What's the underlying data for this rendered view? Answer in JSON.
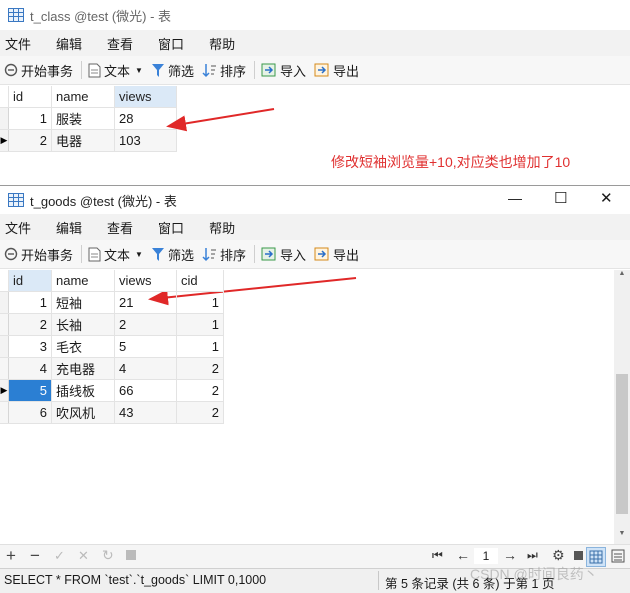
{
  "top_window": {
    "title": "t_class @test (微光) - 表",
    "menu": [
      "文件",
      "编辑",
      "查看",
      "窗口",
      "帮助"
    ],
    "toolbar": {
      "begin_tx": "开始事务",
      "text": "文本",
      "filter": "筛选",
      "sort": "排序",
      "import": "导入",
      "export": "导出"
    },
    "columns": [
      "id",
      "name",
      "views"
    ],
    "rows": [
      {
        "id": "1",
        "name": "服装",
        "views": "28"
      },
      {
        "id": "2",
        "name": "电器",
        "views": "103"
      }
    ]
  },
  "annotation": "修改短袖浏览量+10,对应类也增加了10",
  "bottom_window": {
    "title": "t_goods @test (微光) - 表",
    "menu": [
      "文件",
      "编辑",
      "查看",
      "窗口",
      "帮助"
    ],
    "toolbar": {
      "begin_tx": "开始事务",
      "text": "文本",
      "filter": "筛选",
      "sort": "排序",
      "import": "导入",
      "export": "导出"
    },
    "controls": {
      "minimize": "—",
      "maximize": "☐",
      "close": "✕"
    },
    "columns": [
      "id",
      "name",
      "views",
      "cid"
    ],
    "rows": [
      {
        "id": "1",
        "name": "短袖",
        "views": "21",
        "cid": "1"
      },
      {
        "id": "2",
        "name": "长袖",
        "views": "2",
        "cid": "1"
      },
      {
        "id": "3",
        "name": "毛衣",
        "views": "5",
        "cid": "1"
      },
      {
        "id": "4",
        "name": "充电器",
        "views": "4",
        "cid": "2"
      },
      {
        "id": "5",
        "name": "插线板",
        "views": "66",
        "cid": "2"
      },
      {
        "id": "6",
        "name": "吹风机",
        "views": "43",
        "cid": "2"
      }
    ],
    "page": "1",
    "status_sql": "SELECT * FROM `test`.`t_goods` LIMIT 0,1000",
    "status_record": "第 5 条记录 (共 6 条) 于第 1 页"
  },
  "watermark": "CSDN @时间良药丶",
  "colors": {
    "selection": "#2b7fd3",
    "header_selected": "#dbe9f7",
    "annotation": "#e03030",
    "arrow": "#e02828"
  }
}
